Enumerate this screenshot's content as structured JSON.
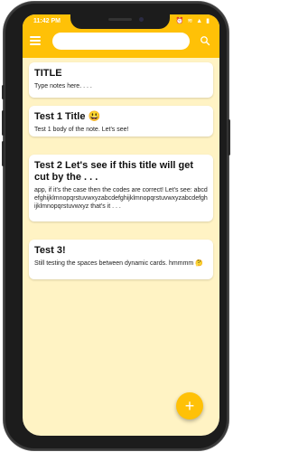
{
  "status_bar": {
    "time": "11:42 PM",
    "icons": "⏰ ≋ ▲ ▮"
  },
  "app_bar": {
    "menu_icon": "hamburger-menu-icon",
    "search_placeholder": "",
    "search_value": "",
    "search_icon": "search-icon"
  },
  "notes": [
    {
      "title": "TITLE",
      "body": "Type notes here. . . ."
    },
    {
      "title": "Test 1 Title 😃",
      "body": "Test 1 body of the note. Let's see!"
    },
    {
      "title": "Test 2 Let's see if this title will get cut by the . . .",
      "body": "app, if it's the case then the codes are correct! Let's see: abcdefghijklmnopqrstuvwxyzabcdefghijklmnopqrstuvwxyzabcdefghijklmnopqrstuvwxyz that's it . . ."
    },
    {
      "title": "Test 3!",
      "body": "Still testing the spaces between dynamic cards. hmmmm 🤔"
    }
  ],
  "fab": {
    "label": "+"
  },
  "colors": {
    "accent": "#ffc107",
    "background": "#fff3c4",
    "card": "#ffffff"
  }
}
